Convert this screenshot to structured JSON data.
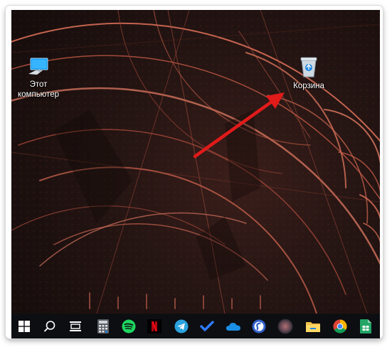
{
  "desktop": {
    "icons": [
      {
        "label_line1": "Этот",
        "label_line2": "компьютер",
        "icon": "this-pc-icon"
      },
      {
        "label": "Корзина",
        "icon": "recycle-bin-icon"
      }
    ],
    "annotation": {
      "type": "arrow",
      "color": "#e11a1a",
      "points_to": "recycle-bin-icon"
    }
  },
  "taskbar": {
    "apps": [
      {
        "name": "start",
        "icon": "windows-start-icon"
      },
      {
        "name": "search",
        "icon": "search-icon"
      },
      {
        "name": "task-view",
        "icon": "task-view-icon"
      },
      {
        "name": "calculator",
        "icon": "calculator-icon"
      },
      {
        "name": "spotify",
        "icon": "spotify-icon"
      },
      {
        "name": "netflix",
        "icon": "netflix-icon",
        "glyph": "N"
      },
      {
        "name": "telegram",
        "icon": "telegram-icon"
      },
      {
        "name": "todo",
        "icon": "todo-check-icon"
      },
      {
        "name": "onedrive",
        "icon": "onedrive-icon"
      },
      {
        "name": "simplenote",
        "icon": "simplenote-icon"
      },
      {
        "name": "blurred-app",
        "icon": "app-icon"
      },
      {
        "name": "file-explorer",
        "icon": "file-explorer-icon"
      },
      {
        "name": "chrome",
        "icon": "chrome-icon"
      },
      {
        "name": "sheets",
        "icon": "sheets-icon"
      }
    ],
    "colors": {
      "accent": "#0078d7",
      "taskbar_bg": "#0d0e12"
    }
  }
}
